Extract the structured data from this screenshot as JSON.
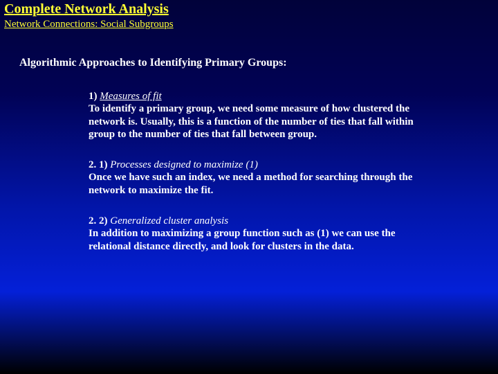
{
  "header": {
    "title": "Complete Network Analysis",
    "subtitle": "Network Connections: Social Subgroups"
  },
  "section_heading": "Algorithmic Approaches to Identifying Primary Groups:",
  "items": [
    {
      "label": "1) ",
      "title": "Measures of fit",
      "body": "To identify a primary group, we need some measure of how clustered the network is.   Usually, this is a function of the number of ties that fall within group to the number of ties that fall between group."
    },
    {
      "label": "2. 1) ",
      "title": "Processes designed to maximize (1)",
      "body": "Once we have such an index, we need a method for searching through the network to maximize the fit."
    },
    {
      "label": "2. 2) ",
      "title": "Generalized cluster analysis",
      "body": "In addition to maximizing a group function such as (1) we can use the relational distance directly, and look for clusters in the data."
    }
  ]
}
